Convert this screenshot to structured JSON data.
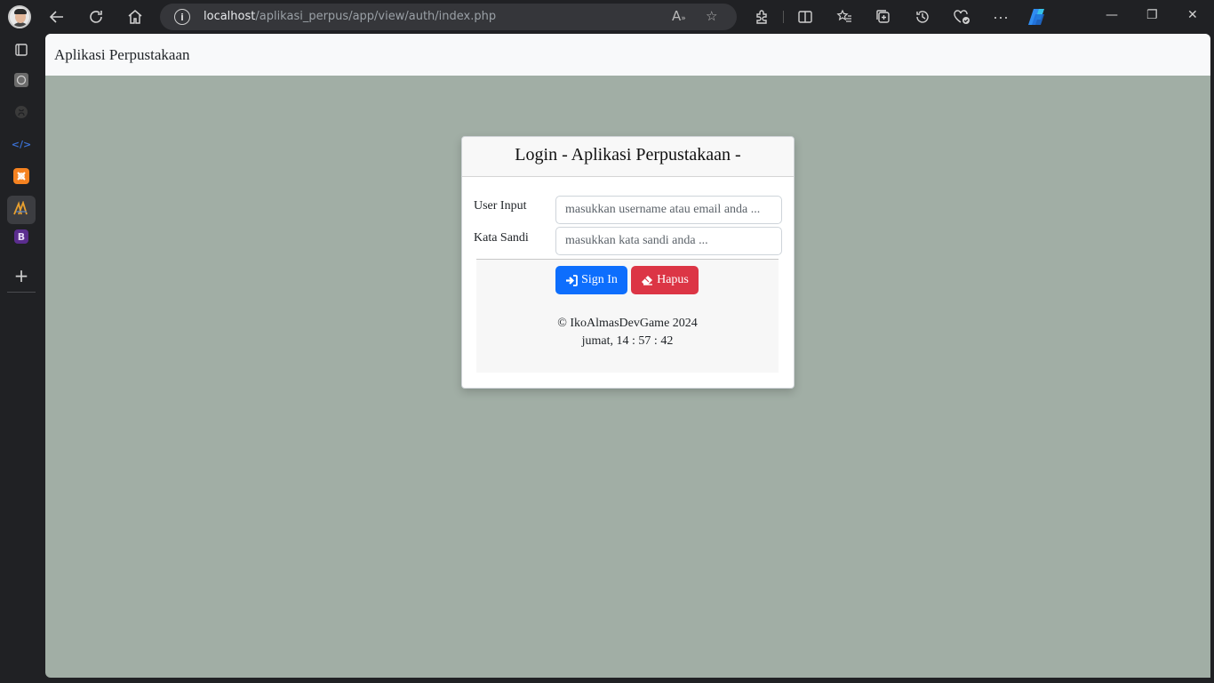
{
  "browser": {
    "url_host": "localhost",
    "url_path": "/aplikasi_perpus/app/view/auth/index.php"
  },
  "navbar": {
    "brand": "Aplikasi Perpustakaan"
  },
  "login": {
    "title": "Login - Aplikasi Perpustakaan -",
    "user_label": "User Input",
    "user_placeholder": "masukkan username atau email anda ...",
    "password_label": "Kata Sandi",
    "password_placeholder": "masukkan kata sandi anda ...",
    "signin_label": "Sign In",
    "reset_label": "Hapus",
    "copyright": "© IkoAlmasDevGame 2024",
    "clock": "jumat, 14 : 57 : 42"
  },
  "sidebar": {
    "bootstrap_letter": "B"
  },
  "colors": {
    "primary": "#0d6efd",
    "danger": "#dc3545",
    "page_bg": "#a1aea5"
  }
}
